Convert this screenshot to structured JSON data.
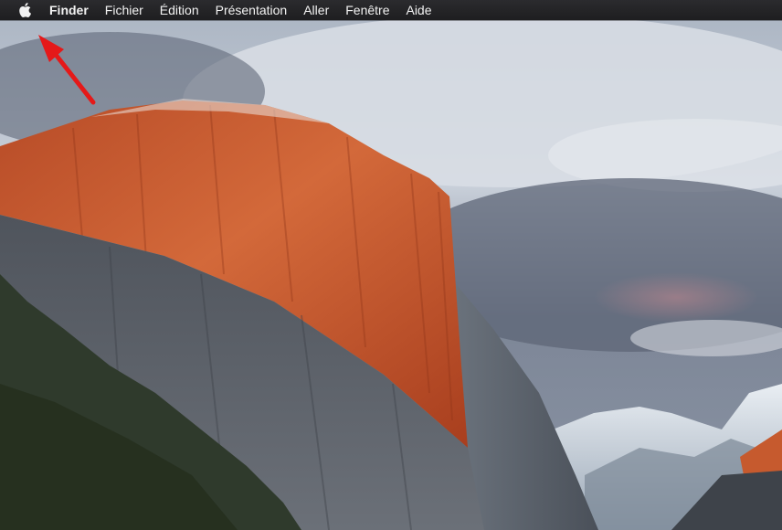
{
  "menubar": {
    "apple_icon": "apple-icon",
    "app_name": "Finder",
    "items": [
      {
        "label": "Fichier"
      },
      {
        "label": "Édition"
      },
      {
        "label": "Présentation"
      },
      {
        "label": "Aller"
      },
      {
        "label": "Fenêtre"
      },
      {
        "label": "Aide"
      }
    ]
  },
  "annotation": {
    "arrow_icon": "red-arrow-icon",
    "color": "#e51919"
  },
  "colors": {
    "menubar_bg": "#242426",
    "menubar_text": "#f2f2f2",
    "sky": "#8e9aab",
    "cliff_lit": "#c4562b",
    "cliff_shadow": "#5a5f66"
  }
}
